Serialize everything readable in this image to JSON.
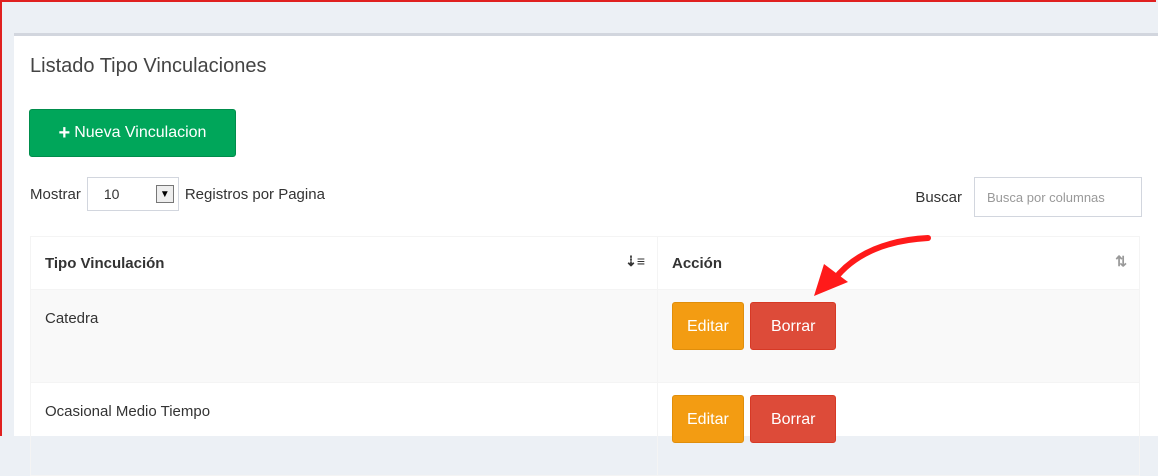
{
  "panel": {
    "title": "Listado Tipo Vinculaciones"
  },
  "toolbar": {
    "new_label": "Nueva Vinculacion"
  },
  "length": {
    "prefix": "Mostrar",
    "selected": "10",
    "suffix": "Registros por Pagina"
  },
  "search": {
    "label": "Buscar",
    "placeholder": "Busca por columnas"
  },
  "table": {
    "headers": [
      "Tipo Vinculación",
      "Acción"
    ],
    "rows": [
      {
        "name": "Catedra",
        "edit": "Editar",
        "delete": "Borrar"
      },
      {
        "name": "Ocasional Medio Tiempo",
        "edit": "Editar",
        "delete": "Borrar"
      }
    ]
  },
  "colors": {
    "primary_btn": "#00a65a",
    "edit_btn": "#f39c12",
    "delete_btn": "#dd4b39",
    "annotation": "#ff0000"
  },
  "icons": [
    "plus-icon",
    "dropdown-arrow-icon",
    "sort-asc-icon",
    "sort-icon",
    "annotation-arrow"
  ]
}
